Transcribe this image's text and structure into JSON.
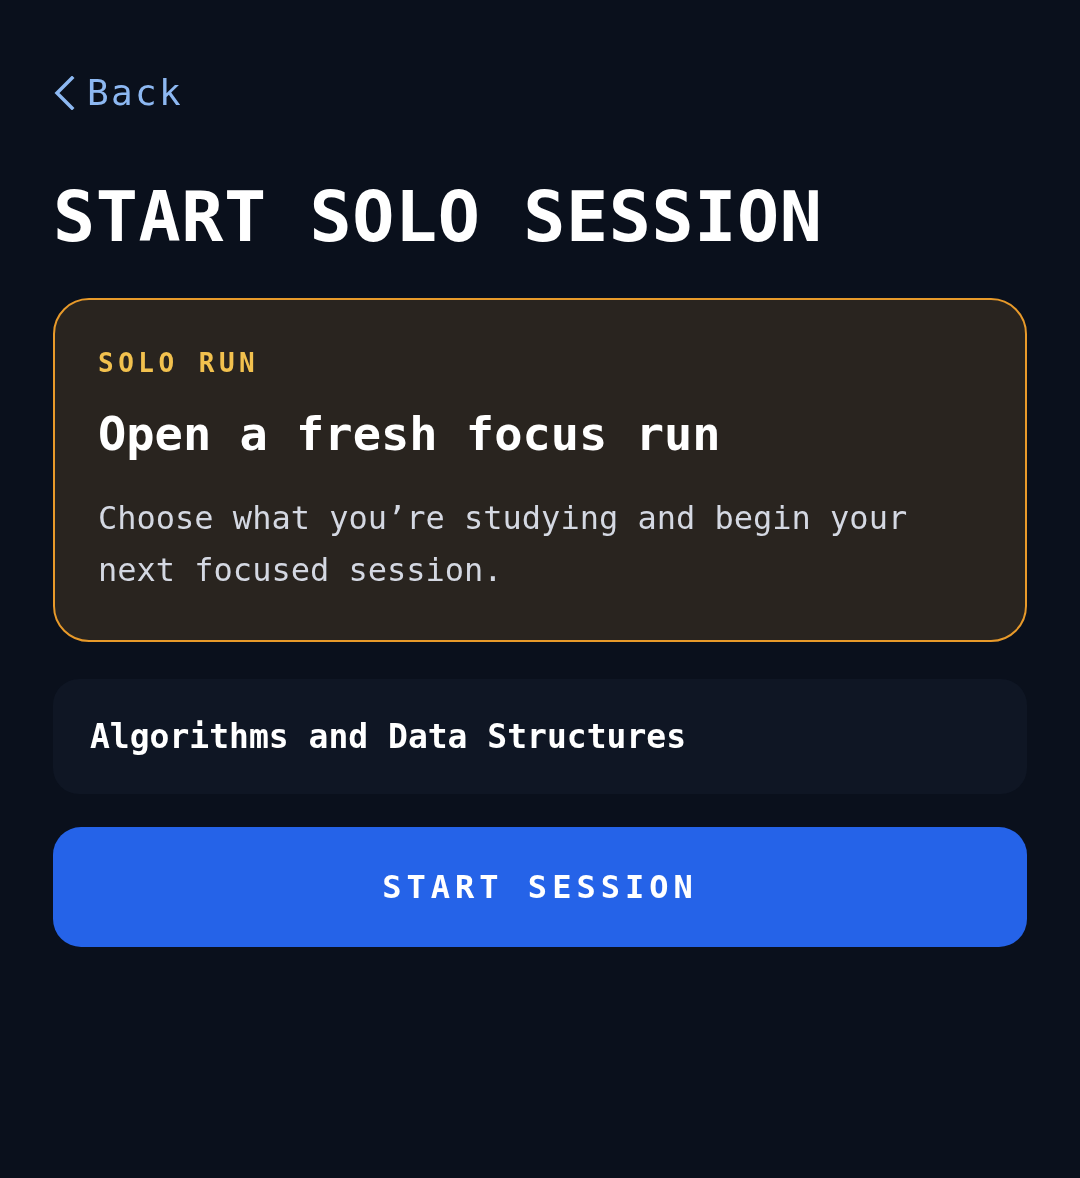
{
  "back": {
    "label": "Back"
  },
  "title": "START SOLO SESSION",
  "card": {
    "eyebrow": "SOLO RUN",
    "heading": "Open a fresh focus run",
    "description": "Choose what you’re studying and begin your next focused session."
  },
  "subject_field": {
    "value": "Algorithms and Data Structures"
  },
  "start_button": {
    "label": "START SESSION"
  }
}
